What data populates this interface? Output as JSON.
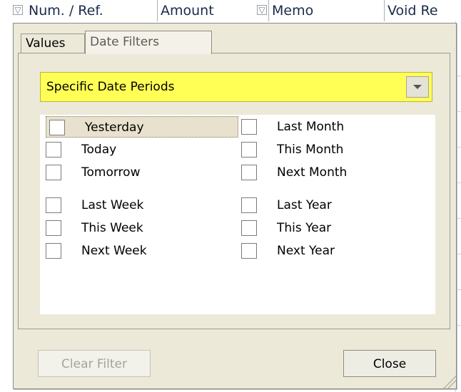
{
  "grid_header": {
    "columns": [
      "Num. / Ref.",
      "Amount",
      "Memo",
      "Void Re"
    ]
  },
  "tabs": [
    {
      "label": "Values",
      "active": false
    },
    {
      "label": "Date Filters",
      "active": true
    }
  ],
  "period_select": {
    "value": "Specific Date Periods"
  },
  "options": {
    "left": [
      {
        "label": "Yesterday",
        "checked": false,
        "focused": true
      },
      {
        "label": "Today",
        "checked": false
      },
      {
        "label": "Tomorrow",
        "checked": false
      },
      {
        "label": "Last Week",
        "checked": false
      },
      {
        "label": "This Week",
        "checked": false
      },
      {
        "label": "Next Week",
        "checked": false
      }
    ],
    "right": [
      {
        "label": "Last Month",
        "checked": false
      },
      {
        "label": "This Month",
        "checked": false
      },
      {
        "label": "Next Month",
        "checked": false
      },
      {
        "label": "Last Year",
        "checked": false
      },
      {
        "label": "This Year",
        "checked": false
      },
      {
        "label": "Next Year",
        "checked": false
      }
    ]
  },
  "buttons": {
    "clear_filter": "Clear Filter",
    "close": "Close"
  },
  "colors": {
    "panel_bg": "#ece9d8",
    "dropdown_highlight": "#ffff55",
    "header_text": "#1b2a4a"
  }
}
